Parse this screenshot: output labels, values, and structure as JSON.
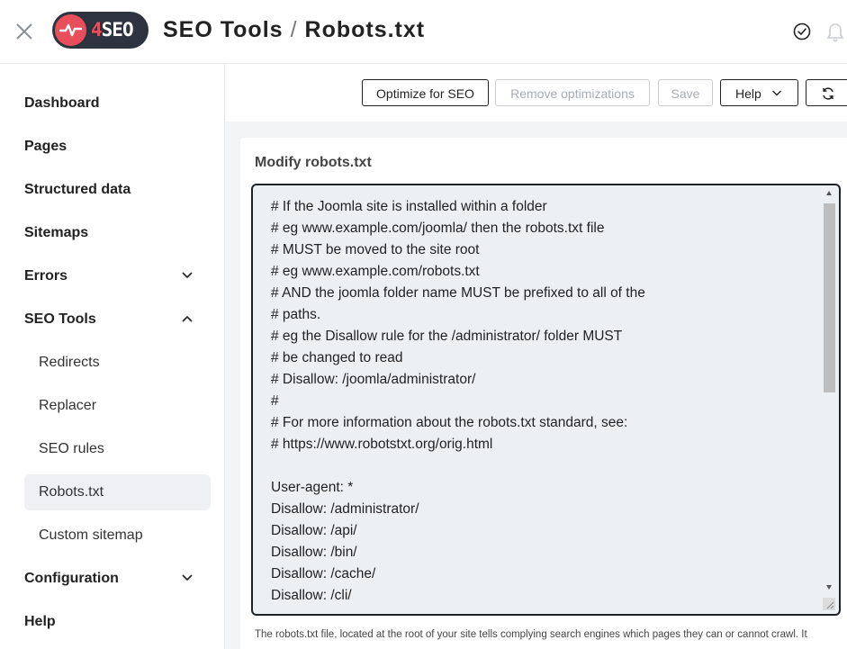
{
  "header": {
    "logo_text_accent": "4",
    "logo_text": "SEO",
    "breadcrumb_section": "SEO Tools",
    "breadcrumb_separator": "/",
    "breadcrumb_page": "Robots.txt"
  },
  "sidebar": {
    "items": [
      {
        "label": "Dashboard"
      },
      {
        "label": "Pages"
      },
      {
        "label": "Structured data"
      },
      {
        "label": "Sitemaps"
      },
      {
        "label": "Errors"
      },
      {
        "label": "SEO Tools"
      },
      {
        "label": "Redirects"
      },
      {
        "label": "Replacer"
      },
      {
        "label": "SEO rules"
      },
      {
        "label": "Robots.txt"
      },
      {
        "label": "Custom sitemap"
      },
      {
        "label": "Configuration"
      },
      {
        "label": "Help"
      }
    ],
    "active_item": "Robots.txt"
  },
  "toolbar": {
    "optimize_label": "Optimize for SEO",
    "remove_label": "Remove optimizations",
    "save_label": "Save",
    "help_label": "Help"
  },
  "editor": {
    "title": "Modify robots.txt",
    "lines": [
      "# If the Joomla site is installed within a folder",
      "# eg www.example.com/joomla/ then the robots.txt file",
      "# MUST be moved to the site root",
      "# eg www.example.com/robots.txt",
      "# AND the joomla folder name MUST be prefixed to all of the",
      "# paths.",
      "# eg the Disallow rule for the /administrator/ folder MUST",
      "# be changed to read",
      "# Disallow: /joomla/administrator/",
      "#",
      "# For more information about the robots.txt standard, see:",
      "# https://www.robotstxt.org/orig.html",
      "",
      "User-agent: *",
      "Disallow: /administrator/",
      "Disallow: /api/",
      "Disallow: /bin/",
      "Disallow: /cache/",
      "Disallow: /cli/"
    ],
    "help_text": "The robots.txt file, located at the root of your site tells complying search engines which pages they can or cannot crawl. It"
  },
  "colors": {
    "brand_red": "#e94f5b",
    "brand_dark": "#2d3440",
    "active_bg": "#eef0f3"
  }
}
